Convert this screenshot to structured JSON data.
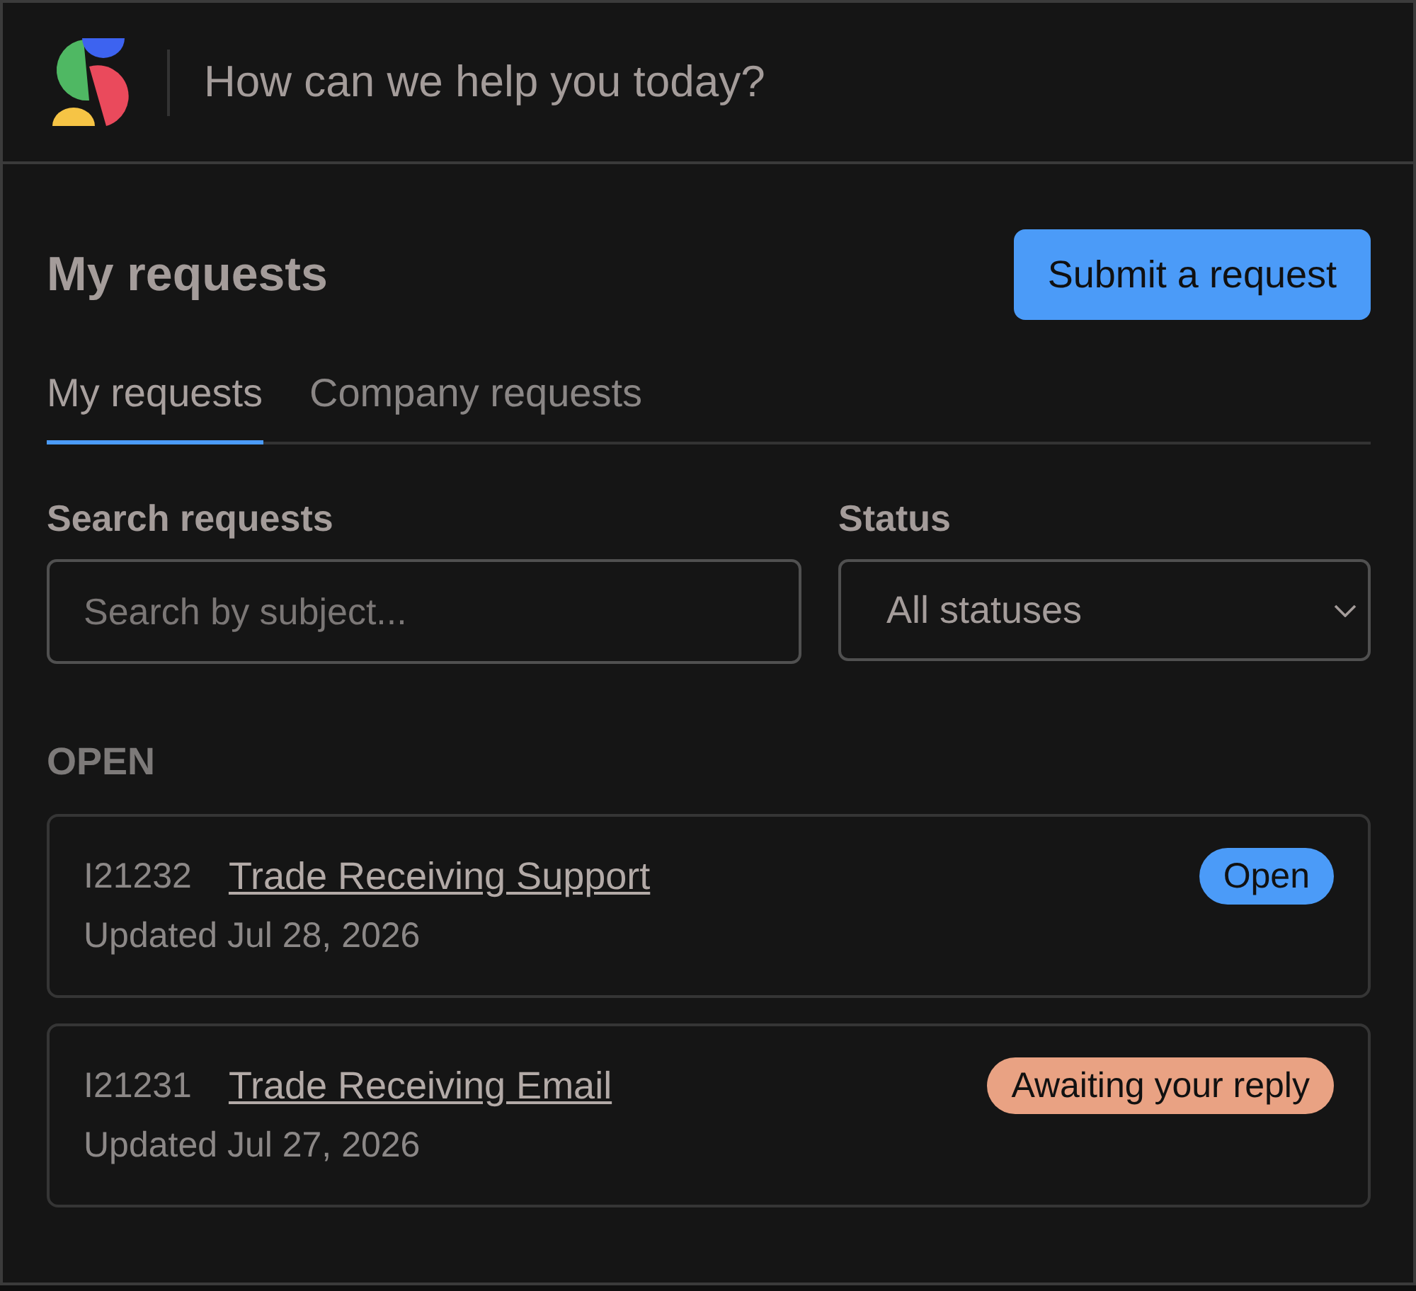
{
  "header": {
    "title": "How can we help you today?"
  },
  "page": {
    "heading": "My requests",
    "submit_button": "Submit a request"
  },
  "tabs": [
    {
      "label": "My requests",
      "selected": true
    },
    {
      "label": "Company requests",
      "selected": false
    }
  ],
  "filters": {
    "search": {
      "label": "Search requests",
      "placeholder": "Search by subject..."
    },
    "status": {
      "label": "Status",
      "value": "All statuses"
    }
  },
  "sections": [
    {
      "title": "OPEN",
      "requests": [
        {
          "id": "I21232",
          "subject": "Trade Receiving Support",
          "updated": "Updated Jul 28, 2026",
          "status": {
            "label": "Open",
            "color": "#4b9bf8"
          }
        },
        {
          "id": "I21231",
          "subject": "Trade Receiving Email",
          "updated": "Updated Jul 27, 2026",
          "status": {
            "label": "Awaiting your reply",
            "color": "#e9a283"
          }
        }
      ]
    }
  ]
}
